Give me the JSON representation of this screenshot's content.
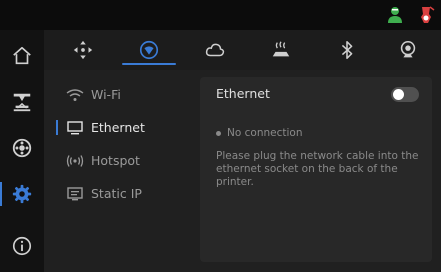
{
  "status_icons": [
    {
      "icon": "user-status-icon",
      "color": "#3fae4f"
    },
    {
      "icon": "alert-status-icon",
      "color": "#d94040"
    }
  ],
  "sidebar": {
    "items": [
      {
        "icon": "home-icon"
      },
      {
        "icon": "printer-icon"
      },
      {
        "icon": "filament-spool-icon"
      },
      {
        "icon": "settings-gear-icon",
        "active": true
      },
      {
        "icon": "info-icon"
      }
    ]
  },
  "tabs": [
    {
      "icon": "move-axes-icon"
    },
    {
      "icon": "network-icon",
      "active": true
    },
    {
      "icon": "cloud-icon"
    },
    {
      "icon": "heated-bed-icon"
    },
    {
      "icon": "bluetooth-icon"
    },
    {
      "icon": "camera-icon"
    }
  ],
  "network_menu": {
    "items": [
      {
        "label": "Wi-Fi",
        "icon": "wifi-icon"
      },
      {
        "label": "Ethernet",
        "icon": "monitor-icon",
        "active": true
      },
      {
        "label": "Hotspot",
        "icon": "hotspot-icon"
      },
      {
        "label": "Static IP",
        "icon": "static-ip-icon"
      }
    ]
  },
  "panel": {
    "title": "Ethernet",
    "toggle_on": false,
    "status": "No connection",
    "help": "Please plug the network cable into the ethernet socket on the back of the printer."
  },
  "colors": {
    "accent": "#3a7bd5",
    "background": "#0a0a0a",
    "content": "#202020",
    "panel": "#282828"
  }
}
